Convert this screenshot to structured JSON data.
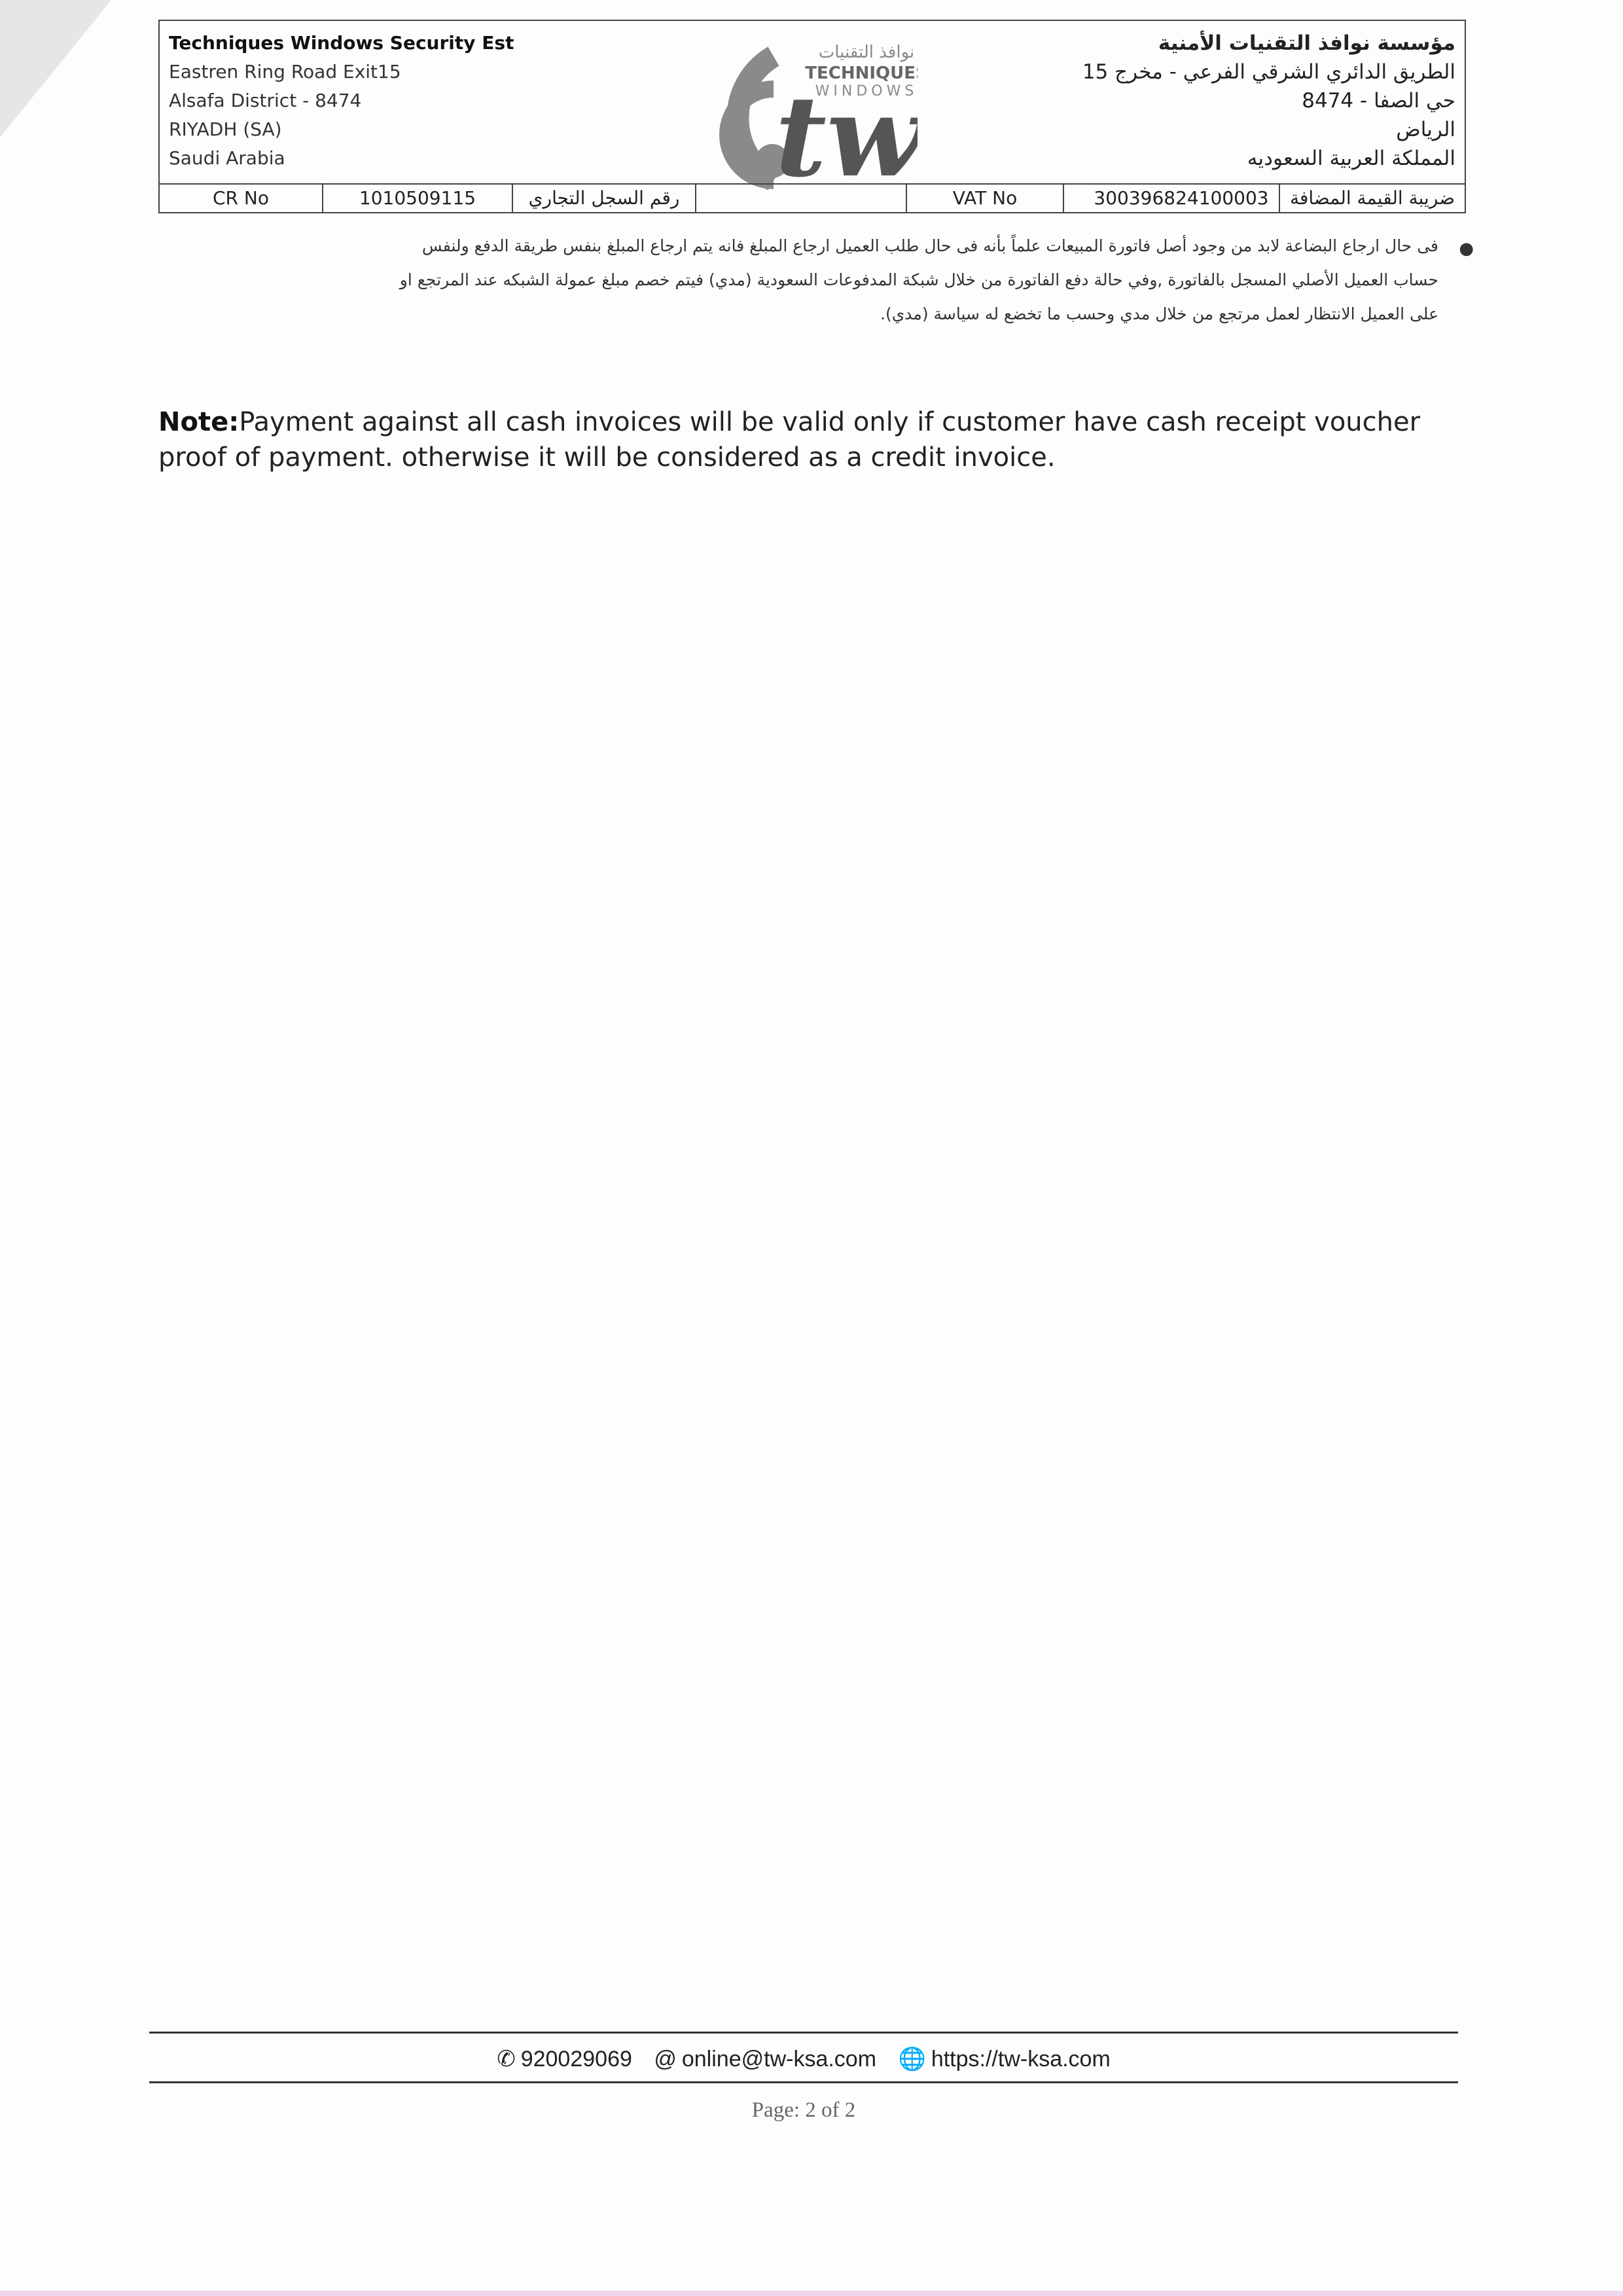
{
  "header": {
    "company_en": {
      "name": "Techniques Windows Security Est",
      "address_lines": [
        "Eastren Ring Road Exit15",
        "Alsafa District - 8474",
        "RIYADH (SA)",
        "Saudi Arabia"
      ]
    },
    "company_ar": {
      "name": "مؤسسة نوافذ التقنيات الأمنية",
      "address_lines": [
        "الطريق الدائري الشرقي الفرعي - مخرج 15",
        "حي الصفا - 8474",
        "الرياض",
        "المملكة العربية السعوديه"
      ]
    },
    "logo": {
      "arabic": "نوافذ التقنيات",
      "line1": "TECHNIQUES",
      "line2": "WINDOWS",
      "mark": "tw",
      "gray": "#8a8a8a",
      "dark": "#555555"
    },
    "registration": {
      "cr_label": "CR No",
      "cr_value": "1010509115",
      "cr_label_ar": "رقم السجل التجاري",
      "vat_label": "VAT No",
      "vat_value": "300396824100003",
      "vat_label_ar": "ضريبة القيمة المضافة"
    }
  },
  "policy": {
    "lines": [
      "فى حال ارجاع البضاعة لابد من وجود أصل فاتورة المبيعات علماً بأنه فى حال طلب العميل ارجاع المبلغ فانه يتم ارجاع المبلغ بنفس طريقة الدفع ولنفس",
      "حساب العميل الأصلي المسجل بالفاتورة ,وفي حالة دفع الفاتورة من خلال شبكة المدفوعات السعودية (مدي) فيتم خصم مبلغ عمولة الشبكه عند المرتجع او",
      "على العميل الانتظار لعمل مرتجع من خلال مدي وحسب ما تخضع له سياسة (مدي)."
    ]
  },
  "note": {
    "label": "Note:",
    "text": "Payment against all cash invoices will be valid only if customer have cash receipt voucher proof of payment. otherwise it will be considered as a credit invoice."
  },
  "footer": {
    "phone": "920029069",
    "email": "online@tw-ksa.com",
    "website": "https://tw-ksa.com",
    "page_label": "Page: 2 of 2"
  }
}
